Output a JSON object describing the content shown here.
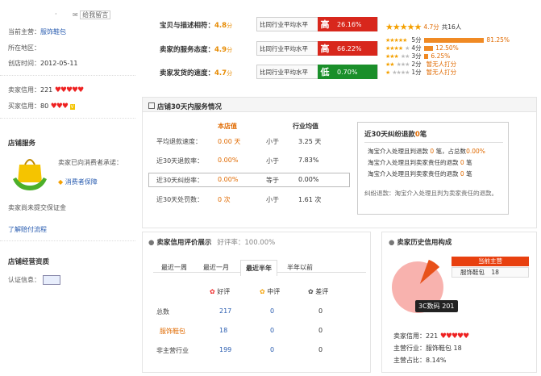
{
  "left": {
    "shop_owner": "·",
    "message_link": "给我留言",
    "main_business_label": "当前主营：",
    "main_business_value": "服饰鞋包",
    "location_label": "所在地区：",
    "location_value": "",
    "created_label": "创店时间：",
    "created_value": "2012-05-11",
    "seller_credit_label": "卖家信用：",
    "seller_credit_value": "221",
    "buyer_credit_label": "买家信用：",
    "buyer_credit_value": "80",
    "shop_service_title": "店铺服务",
    "promise_text": "卖家已向消费者承诺：",
    "consumer_protection": "消费者保障",
    "no_deposit": "卖家尚未提交保证金",
    "learn_flow": "了解赔付流程",
    "qualification_title": "店铺经营资质",
    "cert_label": "认证信息："
  },
  "dsr": [
    {
      "label": "宝贝与描述相符：",
      "score": "4.8",
      "unit": "分",
      "compare": "比同行业平均水平",
      "level": "高",
      "pct": "26.16%",
      "color": "#d8271c"
    },
    {
      "label": "卖家的服务态度：",
      "score": "4.9",
      "unit": "分",
      "compare": "比同行业平均水平",
      "level": "高",
      "pct": "66.22%",
      "color": "#d8271c"
    },
    {
      "label": "卖家发货的速度：",
      "score": "4.7",
      "unit": "分",
      "compare": "比同行业平均水平",
      "level": "低",
      "pct": "0.70%",
      "color": "#1a8f2a"
    }
  ],
  "rating": {
    "score_text": "4.7分",
    "total_text": "共16人",
    "rows": [
      {
        "label": "5分",
        "pct": "81.25%",
        "fill": 0.8125
      },
      {
        "label": "4分",
        "pct": "12.50%",
        "fill": 0.125
      },
      {
        "label": "3分",
        "pct": "6.25%",
        "fill": 0.0625
      },
      {
        "label": "2分",
        "pct": "暂无人打分",
        "fill": 0
      },
      {
        "label": "1分",
        "pct": "暂无人打分",
        "fill": 0
      }
    ]
  },
  "service": {
    "title": "店铺30天内服务情况",
    "col_shop": "本店值",
    "col_avg": "行业均值",
    "rows": [
      {
        "label": "平均退款速度：",
        "value": "0.00 天",
        "cmp": "小于",
        "avg": "3.25 天"
      },
      {
        "label": "近30天退款率：",
        "value": "0.00%",
        "cmp": "小于",
        "avg": "7.83%"
      },
      {
        "label": "近30天纠纷率：",
        "value": "0.00%",
        "cmp": "等于",
        "avg": "0.00%"
      },
      {
        "label": "近30天处罚数：",
        "value": "0 次",
        "cmp": "小于",
        "avg": "1.61 次"
      }
    ]
  },
  "dispute": {
    "title_prefix": "近30天纠纷退款",
    "title_count": "0",
    "title_suffix": "笔",
    "lines": [
      {
        "a": "淘宝介入处理且判退款",
        "n": "0",
        "b": "笔，占总数",
        "c": "0.00%"
      },
      {
        "a": "淘宝介入处理且判卖家责任的退款",
        "n": "0",
        "b": "笔",
        "c": ""
      },
      {
        "a": "淘宝介入处理且判卖家责任的退款",
        "n": "0",
        "b": "笔",
        "c": ""
      }
    ],
    "note": "纠纷退款：淘宝介入处理且判为卖家责任的退款。"
  },
  "credit": {
    "title": "卖家信用评价展示",
    "good_rate": "好评率：100.00%",
    "tabs": [
      "最近一周",
      "最近一月",
      "最近半年",
      "半年以前"
    ],
    "active_tab": 2,
    "heads": [
      "好评",
      "中评",
      "差评"
    ],
    "rows": [
      {
        "label": "总数",
        "good": "217",
        "mid": "0",
        "bad": "0"
      },
      {
        "label": "服饰鞋包",
        "good": "18",
        "mid": "0",
        "bad": "0"
      },
      {
        "label": "非主营行业",
        "good": "199",
        "mid": "0",
        "bad": "0"
      }
    ]
  },
  "history": {
    "title": "卖家历史信用构成",
    "tag_current": "当前主营",
    "tag_main": "服饰鞋包",
    "tag_main_n": "18",
    "tip": "3C数码 201",
    "seller_credit_label": "卖家信用：",
    "seller_credit_value": "221",
    "industry_label": "主营行业：",
    "industry_value": "服饰鞋包",
    "industry_n": "18",
    "share_label": "主营占比：",
    "share_value": "8.14%",
    "share_fraction": 0.0814
  },
  "colors": {
    "accent": "#e06a00",
    "link": "#2a5db0",
    "bar": "#f08a24",
    "pie": "#f8b2ae",
    "pie_slice": "#e8511a"
  }
}
